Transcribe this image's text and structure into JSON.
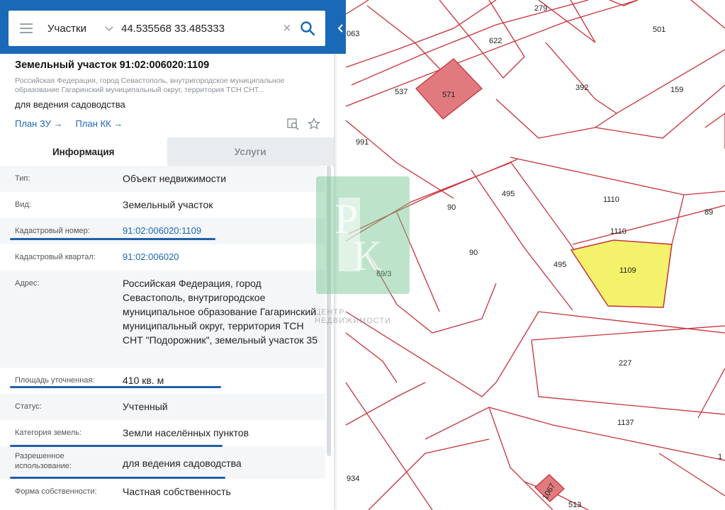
{
  "search": {
    "layer": "Участки",
    "query": "44.535568 33.485333"
  },
  "parcel": {
    "title": "Земельный участок 91:02:006020:1109",
    "address_short": "Российская Федерация, город Севастополь, внутригородское муниципальное образование Гагаринский муниципальный округ, территория ТСН СНТ...",
    "purpose": "для ведения садоводства",
    "links": {
      "plan_zu": "План ЗУ",
      "plan_kk": "План КК"
    }
  },
  "tabs": {
    "info": "Информация",
    "services": "Услуги"
  },
  "info": [
    {
      "label": "Тип:",
      "value": "Объект недвижимости"
    },
    {
      "label": "Вид:",
      "value": "Земельный участок"
    },
    {
      "label": "Кадастровый номер:",
      "value": "91:02:006020:1109"
    },
    {
      "label": "Кадастровый квартал:",
      "value": "91:02:006020"
    },
    {
      "label": "Адрес:",
      "value": "Российская Федерация, город Севастополь, внутригородское муниципальное образование Гагаринский муниципальный округ, территория ТСН СНТ \"Подорожник\", земельный участок 35"
    },
    {
      "label": "Площадь уточненная:",
      "value": "410 кв. м"
    },
    {
      "label": "Статус:",
      "value": "Учтенный"
    },
    {
      "label": "Категория земель:",
      "value": "Земли населённых пунктов"
    },
    {
      "label": "Разрешенное использование:",
      "value": "для ведения садоводства"
    },
    {
      "label": "Форма собственности:",
      "value": "Частная собственность"
    }
  ],
  "watermark": {
    "logo_letters": "РК",
    "text": "ЦЕНТР НЕДВИЖИМОСТИ"
  },
  "map": {
    "labels": [
      "063",
      "279",
      "622",
      "501",
      "537",
      "571",
      "392",
      "159",
      "991",
      "1110",
      "89",
      "495",
      "90",
      "1110",
      "90",
      "495",
      "1109",
      "69/3",
      "227",
      "1137",
      "934",
      "1067",
      "513",
      "1"
    ]
  },
  "colors": {
    "accent": "#1a68b8",
    "parcel_line": "#c8323a",
    "selected_fill": "#f4f26a",
    "building_fill": "#e07a7e"
  }
}
